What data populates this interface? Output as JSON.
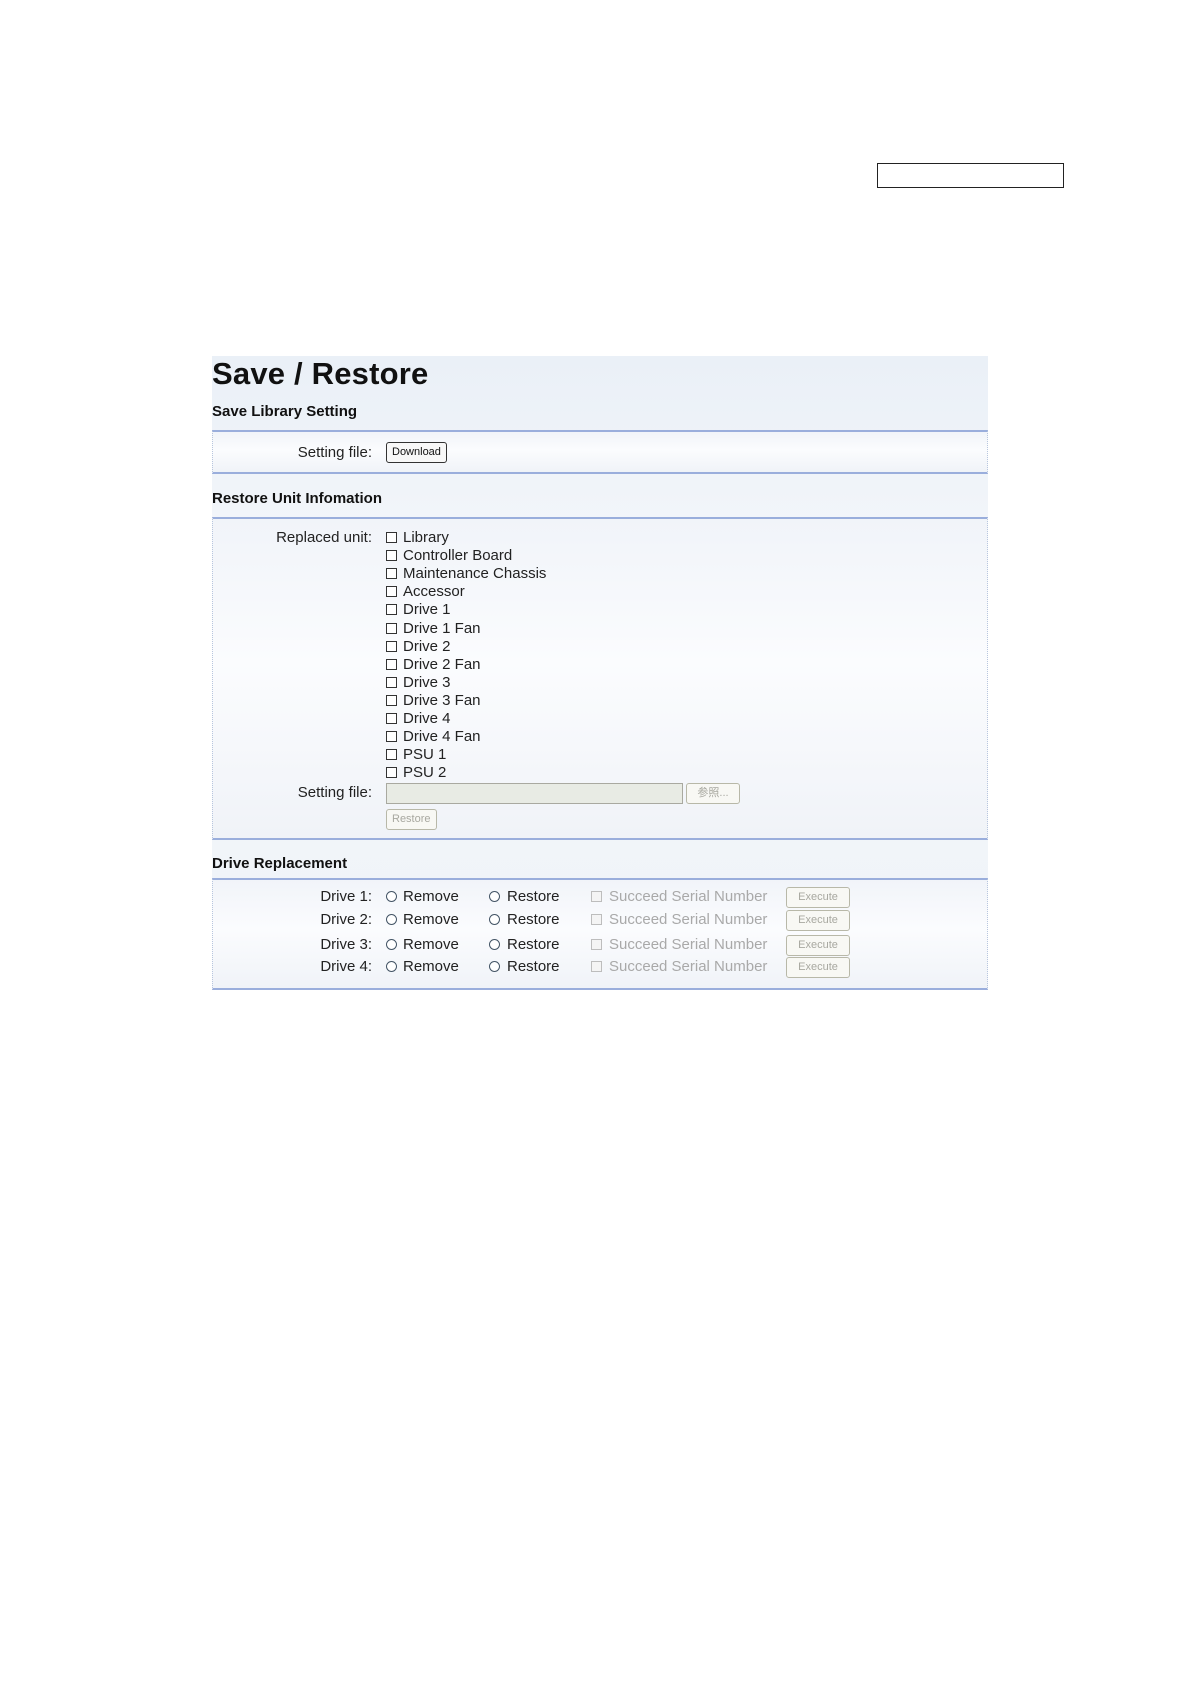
{
  "page": {
    "title": "Save / Restore"
  },
  "save_library": {
    "heading": "Save Library Setting",
    "setting_file_label": "Setting file:",
    "download_button": "Download"
  },
  "restore_unit": {
    "heading": "Restore Unit Infomation",
    "replaced_unit_label": "Replaced unit:",
    "units": [
      "Library",
      "Controller Board",
      "Maintenance Chassis",
      "Accessor",
      "Drive 1",
      "Drive 1 Fan",
      "Drive 2",
      "Drive 2 Fan",
      "Drive 3",
      "Drive 3 Fan",
      "Drive 4",
      "Drive 4 Fan",
      "PSU 1",
      "PSU 2"
    ],
    "setting_file_label": "Setting file:",
    "browse_button": "参照...",
    "restore_button": "Restore"
  },
  "drive_replacement": {
    "heading": "Drive Replacement",
    "rows": [
      {
        "label": "Drive 1:",
        "remove": "Remove",
        "restore": "Restore",
        "succeed": "Succeed Serial Number",
        "execute": "Execute"
      },
      {
        "label": "Drive 2:",
        "remove": "Remove",
        "restore": "Restore",
        "succeed": "Succeed Serial Number",
        "execute": "Execute"
      },
      {
        "label": "Drive 3:",
        "remove": "Remove",
        "restore": "Restore",
        "succeed": "Succeed Serial Number",
        "execute": "Execute"
      },
      {
        "label": "Drive 4:",
        "remove": "Remove",
        "restore": "Restore",
        "succeed": "Succeed Serial Number",
        "execute": "Execute"
      }
    ]
  }
}
